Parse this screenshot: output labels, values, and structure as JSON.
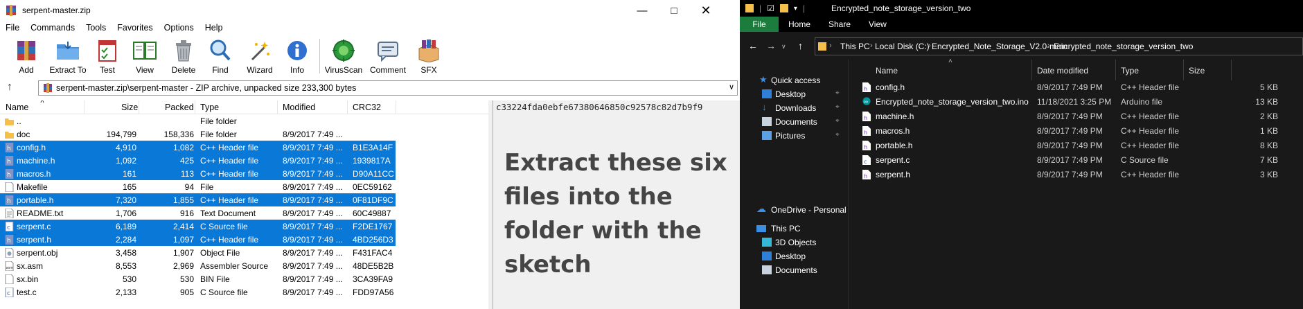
{
  "winrar": {
    "title": "serpent-master.zip",
    "menu": [
      "File",
      "Commands",
      "Tools",
      "Favorites",
      "Options",
      "Help"
    ],
    "toolbar": [
      {
        "label": "Add",
        "icon": "add-archive-icon"
      },
      {
        "label": "Extract To",
        "icon": "extract-folder-icon"
      },
      {
        "label": "Test",
        "icon": "test-checklist-icon"
      },
      {
        "label": "View",
        "icon": "view-book-icon"
      },
      {
        "label": "Delete",
        "icon": "trash-icon"
      },
      {
        "label": "Find",
        "icon": "magnifier-icon"
      },
      {
        "label": "Wizard",
        "icon": "wizard-wand-icon"
      },
      {
        "label": "Info",
        "icon": "info-icon"
      },
      {
        "label": "VirusScan",
        "icon": "virus-scan-icon"
      },
      {
        "label": "Comment",
        "icon": "comment-icon"
      },
      {
        "label": "SFX",
        "icon": "sfx-box-icon"
      }
    ],
    "path": "serpent-master.zip\\serpent-master - ZIP archive, unpacked size 233,300 bytes",
    "columns": {
      "name": "Name",
      "size": "Size",
      "packed": "Packed",
      "type": "Type",
      "modified": "Modified",
      "crc": "CRC32"
    },
    "files": [
      {
        "name": "..",
        "size": "",
        "packed": "",
        "type": "File folder",
        "modified": "",
        "crc": "",
        "icon": "folder",
        "selected": false
      },
      {
        "name": "doc",
        "size": "194,799",
        "packed": "158,336",
        "type": "File folder",
        "modified": "8/9/2017 7:49 ...",
        "crc": "",
        "icon": "folder",
        "selected": false
      },
      {
        "name": "config.h",
        "size": "4,910",
        "packed": "1,082",
        "type": "C++ Header file",
        "modified": "8/9/2017 7:49 ...",
        "crc": "B1E3A14F",
        "icon": "h",
        "selected": true
      },
      {
        "name": "machine.h",
        "size": "1,092",
        "packed": "425",
        "type": "C++ Header file",
        "modified": "8/9/2017 7:49 ...",
        "crc": "1939817A",
        "icon": "h",
        "selected": true
      },
      {
        "name": "macros.h",
        "size": "161",
        "packed": "113",
        "type": "C++ Header file",
        "modified": "8/9/2017 7:49 ...",
        "crc": "D90A11CC",
        "icon": "h",
        "selected": true
      },
      {
        "name": "Makefile",
        "size": "165",
        "packed": "94",
        "type": "File",
        "modified": "8/9/2017 7:49 ...",
        "crc": "0EC59162",
        "icon": "file",
        "selected": false
      },
      {
        "name": "portable.h",
        "size": "7,320",
        "packed": "1,855",
        "type": "C++ Header file",
        "modified": "8/9/2017 7:49 ...",
        "crc": "0F81DF9C",
        "icon": "h",
        "selected": true
      },
      {
        "name": "README.txt",
        "size": "1,706",
        "packed": "916",
        "type": "Text Document",
        "modified": "8/9/2017 7:49 ...",
        "crc": "60C49887",
        "icon": "txt",
        "selected": false
      },
      {
        "name": "serpent.c",
        "size": "6,189",
        "packed": "2,414",
        "type": "C Source file",
        "modified": "8/9/2017 7:49 ...",
        "crc": "F2DE1767",
        "icon": "c",
        "selected": true
      },
      {
        "name": "serpent.h",
        "size": "2,284",
        "packed": "1,097",
        "type": "C++ Header file",
        "modified": "8/9/2017 7:49 ...",
        "crc": "4BD256D3",
        "icon": "h",
        "selected": true
      },
      {
        "name": "serpent.obj",
        "size": "3,458",
        "packed": "1,907",
        "type": "Object File",
        "modified": "8/9/2017 7:49 ...",
        "crc": "F431FAC4",
        "icon": "obj",
        "selected": false
      },
      {
        "name": "sx.asm",
        "size": "8,553",
        "packed": "2,969",
        "type": "Assembler Source",
        "modified": "8/9/2017 7:49 ...",
        "crc": "48DE5B2B",
        "icon": "asm",
        "selected": false
      },
      {
        "name": "sx.bin",
        "size": "530",
        "packed": "530",
        "type": "BIN File",
        "modified": "8/9/2017 7:49 ...",
        "crc": "3CA39FA9",
        "icon": "file",
        "selected": false
      },
      {
        "name": "test.c",
        "size": "2,133",
        "packed": "905",
        "type": "C Source file",
        "modified": "8/9/2017 7:49 ...",
        "crc": "FDD97A56",
        "icon": "c",
        "selected": false
      }
    ],
    "preview_hash": "c33224fda0ebfe67380646850c92578c82d7b9f9",
    "annotation": "Extract these six files into the folder with the sketch"
  },
  "explorer": {
    "title": "Encrypted_note_storage_version_two",
    "ribbon": [
      "File",
      "Home",
      "Share",
      "View"
    ],
    "breadcrumb": [
      "This PC",
      "Local Disk (C:)",
      "Encrypted_Note_Storage_V2.0-main",
      "Encrypted_note_storage_version_two"
    ],
    "nav": [
      {
        "label": "Quick access",
        "icon": "star-icon",
        "pinned": false
      },
      {
        "label": "Desktop",
        "icon": "desktop-icon",
        "pinned": true
      },
      {
        "label": "Downloads",
        "icon": "downloads-icon",
        "pinned": true
      },
      {
        "label": "Documents",
        "icon": "documents-icon",
        "pinned": true
      },
      {
        "label": "Pictures",
        "icon": "pictures-icon",
        "pinned": true
      },
      {
        "label": "OneDrive - Personal",
        "icon": "cloud-icon",
        "pinned": false
      },
      {
        "label": "This PC",
        "icon": "pc-icon",
        "pinned": false
      },
      {
        "label": "3D Objects",
        "icon": "cube-icon",
        "pinned": false
      },
      {
        "label": "Desktop",
        "icon": "desktop-icon",
        "pinned": false
      },
      {
        "label": "Documents",
        "icon": "documents-icon",
        "pinned": false
      }
    ],
    "columns": {
      "name": "Name",
      "date": "Date modified",
      "type": "Type",
      "size": "Size"
    },
    "files": [
      {
        "name": "config.h",
        "date": "8/9/2017 7:49 PM",
        "type": "C++ Header file",
        "size": "5 KB",
        "icon": "h"
      },
      {
        "name": "Encrypted_note_storage_version_two.ino",
        "date": "11/18/2021 3:25 PM",
        "type": "Arduino file",
        "size": "13 KB",
        "icon": "ino"
      },
      {
        "name": "machine.h",
        "date": "8/9/2017 7:49 PM",
        "type": "C++ Header file",
        "size": "2 KB",
        "icon": "h"
      },
      {
        "name": "macros.h",
        "date": "8/9/2017 7:49 PM",
        "type": "C++ Header file",
        "size": "1 KB",
        "icon": "h"
      },
      {
        "name": "portable.h",
        "date": "8/9/2017 7:49 PM",
        "type": "C++ Header file",
        "size": "8 KB",
        "icon": "h"
      },
      {
        "name": "serpent.c",
        "date": "8/9/2017 7:49 PM",
        "type": "C Source file",
        "size": "7 KB",
        "icon": "c"
      },
      {
        "name": "serpent.h",
        "date": "8/9/2017 7:49 PM",
        "type": "C++ Header file",
        "size": "3 KB",
        "icon": "h"
      }
    ]
  },
  "colors": {
    "selection": "#0a78d7",
    "explorer_bg": "#191919",
    "file_tab": "#1b7c3d",
    "folder": "#f5c04a"
  }
}
